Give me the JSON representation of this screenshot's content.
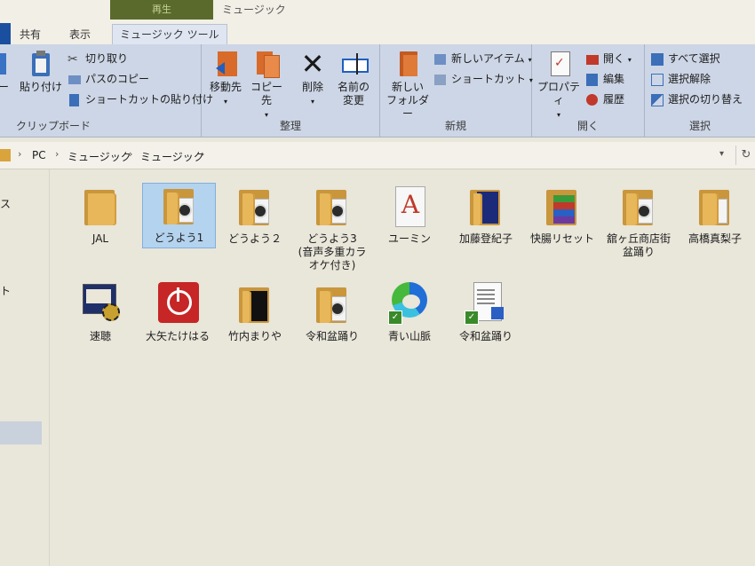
{
  "tabs": {
    "context_header": "再生",
    "window_title": "ミュージック",
    "share": "共有",
    "view": "表示",
    "music_tools": "ミュージック ツール"
  },
  "ribbon": {
    "clipboard": {
      "label": "クリップボード",
      "copy_partial": "ー",
      "paste": "貼り付け",
      "cut": "切り取り",
      "copy_path": "パスのコピー",
      "paste_shortcut": "ショートカットの貼り付け"
    },
    "organize": {
      "label": "整理",
      "move_to": "移動先",
      "copy_to": "コピー先",
      "delete": "削除",
      "rename_line1": "名前の",
      "rename_line2": "変更"
    },
    "new": {
      "label": "新規",
      "new_folder_line1": "新しい",
      "new_folder_line2": "フォルダー",
      "new_item": "新しいアイテム",
      "shortcut": "ショートカット"
    },
    "open": {
      "label": "開く",
      "properties": "プロパティ",
      "open": "開く",
      "edit": "編集",
      "history": "履歴"
    },
    "select": {
      "label": "選択",
      "select_all": "すべて選択",
      "select_none": "選択解除",
      "invert": "選択の切り替え"
    }
  },
  "address": {
    "crumbs": [
      "PC",
      "ミュージック",
      "ミュージック"
    ]
  },
  "nav": {
    "item1": "ス",
    "item2": "ト"
  },
  "files": [
    {
      "name": "JAL",
      "type": "folder"
    },
    {
      "name": "どうよう1",
      "type": "folder-music",
      "selected": true
    },
    {
      "name": "どうよう２",
      "type": "folder-music"
    },
    {
      "name": "どうよう3　(音声多重カラオケ付き)",
      "type": "folder-music"
    },
    {
      "name": "ユーミン",
      "type": "font-file"
    },
    {
      "name": "加藤登紀子",
      "type": "folder-blue"
    },
    {
      "name": "快腸リセット",
      "type": "folder-stripes"
    },
    {
      "name": "舘ヶ丘商店街盆踊り",
      "type": "folder-music"
    },
    {
      "name": "高橋真梨子",
      "type": "folder-doc"
    },
    {
      "name": "速聴",
      "type": "app"
    },
    {
      "name": "大矢たけはる",
      "type": "power-app"
    },
    {
      "name": "竹内まりや",
      "type": "folder-black"
    },
    {
      "name": "令和盆踊り",
      "type": "folder-music"
    },
    {
      "name": "青い山脈",
      "type": "edge-shortcut"
    },
    {
      "name": "令和盆踊り",
      "type": "doc-shortcut"
    }
  ]
}
